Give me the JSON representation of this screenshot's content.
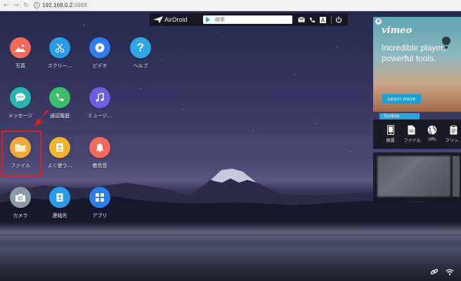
{
  "browser": {
    "url_host": "192.168.0.2",
    "url_port": ":8888"
  },
  "toolbar": {
    "logo_text": "AirDroid",
    "search_placeholder": "検索"
  },
  "apps": [
    {
      "id": "photos",
      "label": "写真",
      "color": "#f26b5b"
    },
    {
      "id": "clips",
      "label": "スクリー...",
      "color": "#2a9be8"
    },
    {
      "id": "video",
      "label": "ビデオ",
      "color": "#2e7ef0"
    },
    {
      "id": "help",
      "label": "ヘルプ",
      "color": "#2aa8e8"
    },
    {
      "id": "messages",
      "label": "メッセージ",
      "color": "#29b6b0"
    },
    {
      "id": "call-log",
      "label": "通話履歴",
      "color": "#3bbf6a"
    },
    {
      "id": "music",
      "label": "ミュージ...",
      "color": "#6b5fe0"
    },
    {
      "id": "files",
      "label": "ファイル",
      "color": "#f2a93b"
    },
    {
      "id": "frequent",
      "label": "よく使う...",
      "color": "#f2b428"
    },
    {
      "id": "ringtones",
      "label": "着信音",
      "color": "#f26b5b"
    },
    {
      "id": "camera",
      "label": "カメラ",
      "color": "#8a9aa8"
    },
    {
      "id": "contacts",
      "label": "連絡先",
      "color": "#2a9be8"
    },
    {
      "id": "apps",
      "label": "アプリ",
      "color": "#2a7ef0"
    }
  ],
  "ad": {
    "brand": "vimeo",
    "headline": "Incredible player, powerful tools.",
    "cta": "Learn more",
    "close": "×"
  },
  "toolbox": {
    "tab_label": "Toolbox",
    "tools": [
      {
        "id": "overview",
        "label": "概要"
      },
      {
        "id": "file",
        "label": "ファイル"
      },
      {
        "id": "url",
        "label": "URL"
      },
      {
        "id": "clipboard",
        "label": "クリッ..."
      }
    ]
  },
  "colors": {
    "highlight": "#e51c1c",
    "toolbox_accent": "#2aa7e0",
    "ad_cta": "#1aa0d8"
  }
}
